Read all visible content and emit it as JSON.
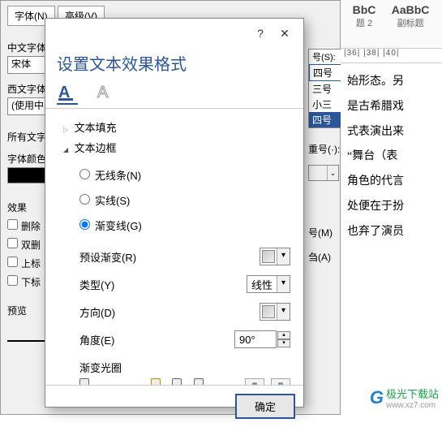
{
  "bg": {
    "tab1": "字体(N)",
    "tab2": "高级(V)",
    "label_cn_font": "中文字体",
    "cn_font_value": "宋体",
    "label_en_font": "西文字体",
    "en_font_value": "(使用中",
    "label_all": "所有文字",
    "label_color": "字体颜色",
    "effects_label": "效果",
    "chk_del": "删除",
    "chk_dbl": "双删",
    "chk_sup": "上标",
    "chk_sub": "下标",
    "preview_label": "预览"
  },
  "sizes": {
    "header": "号(S):",
    "top": "四号",
    "items": [
      "三号",
      "小三",
      "四号"
    ]
  },
  "right_frag": {
    "label_weight": "重号(·):",
    "opt1": "号(M)",
    "opt2": "刍(A)"
  },
  "styles": {
    "s1_sample": "BbC",
    "s1_name": "题 2",
    "s2_sample": "AaBbC",
    "s2_name": "副标题"
  },
  "ruler": " |36|  |38|  |40|",
  "doc_lines": [
    "始形态。另",
    "是古希腊戏",
    "式表演出来",
    "“舞台（表",
    "角色的代言",
    "处便在于扮",
    "也弃了演员"
  ],
  "logo": {
    "brand": "极光下载站",
    "url": "www.xz7.com"
  },
  "dialog": {
    "title": "设置文本效果格式",
    "help": "?",
    "close": "✕",
    "node_fill": "文本填充",
    "node_outline": "文本边框",
    "r_noline": "无线条(N)",
    "r_solid": "实线(S)",
    "r_gradient": "渐变线(G)",
    "lbl_preset": "预设渐变(R)",
    "lbl_type": "类型(Y)",
    "val_type": "线性",
    "lbl_dir": "方向(D)",
    "lbl_angle": "角度(E)",
    "val_angle": "90°",
    "lbl_stops": "渐变光圈",
    "ok": "确定"
  }
}
